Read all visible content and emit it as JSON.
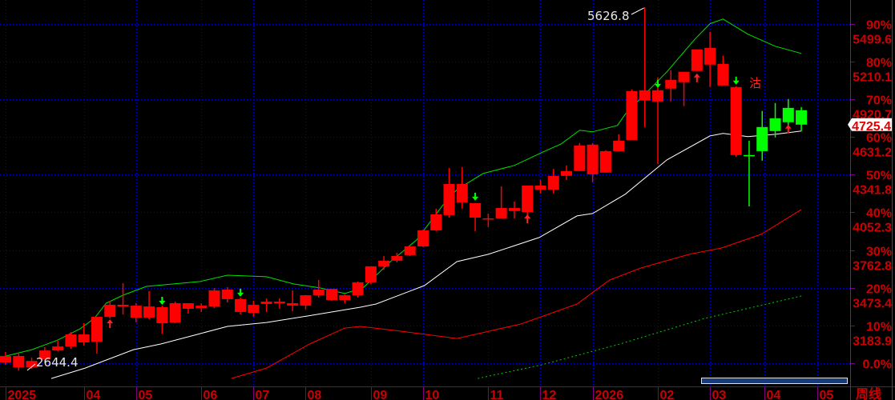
{
  "chart_data": {
    "type": "candlestick",
    "period_label": "周线",
    "ylim": [
      2716,
      5682
    ],
    "base_price": 2894.4,
    "current_price": "4725.4",
    "y_axis": [
      {
        "pct": "90%",
        "price": "5499.6",
        "value": 5499.6
      },
      {
        "pct": "80%",
        "price": "5210.1",
        "value": 5210.1
      },
      {
        "pct": "70%",
        "price": "4920.7",
        "value": 4920.7
      },
      {
        "pct": "60%",
        "price": "4631.2",
        "value": 4631.2
      },
      {
        "pct": "50%",
        "price": "4341.8",
        "value": 4341.8
      },
      {
        "pct": "40%",
        "price": "4052.3",
        "value": 4052.3
      },
      {
        "pct": "30%",
        "price": "3762.8",
        "value": 3762.8
      },
      {
        "pct": "20%",
        "price": "3473.4",
        "value": 3473.4
      },
      {
        "pct": "10%",
        "price": "3183.9",
        "value": 3183.9
      },
      {
        "pct": "0.0%",
        "price": "",
        "value": 2894.4
      }
    ],
    "x_ticks": [
      {
        "label": "2025",
        "week": 0
      },
      {
        "label": "04",
        "week": 6
      },
      {
        "label": "05",
        "week": 10
      },
      {
        "label": "06",
        "week": 15
      },
      {
        "label": "07",
        "week": 19
      },
      {
        "label": "08",
        "week": 23
      },
      {
        "label": "09",
        "week": 28
      },
      {
        "label": "10",
        "week": 32
      },
      {
        "label": "11",
        "week": 37
      },
      {
        "label": "12",
        "week": 41
      },
      {
        "label": "2026",
        "week": 45
      },
      {
        "label": "02",
        "week": 50
      },
      {
        "label": "03",
        "week": 54
      },
      {
        "label": "04",
        "week": 58.2
      },
      {
        "label": "05",
        "week": 62.2
      }
    ],
    "candles_ohlc_color": [
      [
        2900,
        2980,
        2882,
        2950,
        "r"
      ],
      [
        2863,
        2974,
        2839,
        2950,
        "r"
      ],
      [
        2863,
        2937,
        2851,
        2912,
        "r"
      ],
      [
        2925,
        3017,
        2906,
        2992,
        "r"
      ],
      [
        2992,
        3066,
        2986,
        3023,
        "r"
      ],
      [
        3023,
        3134,
        3005,
        3115,
        "r"
      ],
      [
        3054,
        3201,
        3029,
        3115,
        "r"
      ],
      [
        3060,
        3250,
        2968,
        3250,
        "r"
      ],
      [
        3250,
        3373,
        3238,
        3343,
        "r"
      ],
      [
        3330,
        3509,
        3269,
        3343,
        "r"
      ],
      [
        3244,
        3355,
        3207,
        3336,
        "r"
      ],
      [
        3244,
        3447,
        3232,
        3330,
        "r"
      ],
      [
        3201,
        3336,
        3121,
        3324,
        "r"
      ],
      [
        3207,
        3367,
        3201,
        3355,
        "r"
      ],
      [
        3312,
        3355,
        3275,
        3355,
        "r"
      ],
      [
        3318,
        3355,
        3287,
        3336,
        "r"
      ],
      [
        3330,
        3472,
        3318,
        3453,
        "r"
      ],
      [
        3386,
        3478,
        3361,
        3459,
        "r"
      ],
      [
        3287,
        3398,
        3269,
        3386,
        "r"
      ],
      [
        3281,
        3373,
        3250,
        3343,
        "r"
      ],
      [
        3349,
        3392,
        3287,
        3367,
        "r"
      ],
      [
        3355,
        3392,
        3312,
        3367,
        "r"
      ],
      [
        3336,
        3453,
        3293,
        3355,
        "r"
      ],
      [
        3336,
        3416,
        3306,
        3416,
        "r"
      ],
      [
        3416,
        3533,
        3398,
        3459,
        "r"
      ],
      [
        3379,
        3465,
        3373,
        3465,
        "r"
      ],
      [
        3379,
        3422,
        3355,
        3416,
        "r"
      ],
      [
        3416,
        3521,
        3398,
        3515,
        "r"
      ],
      [
        3515,
        3638,
        3502,
        3638,
        "r"
      ],
      [
        3638,
        3717,
        3613,
        3681,
        "r"
      ],
      [
        3681,
        3742,
        3668,
        3717,
        "r"
      ],
      [
        3724,
        3797,
        3717,
        3791,
        "r"
      ],
      [
        3791,
        3920,
        3785,
        3914,
        "r"
      ],
      [
        3914,
        4080,
        3908,
        4037,
        "r"
      ],
      [
        4031,
        4393,
        4012,
        4270,
        "r"
      ],
      [
        4129,
        4400,
        4080,
        4270,
        "r"
      ],
      [
        4012,
        4123,
        3908,
        4123,
        "r"
      ],
      [
        4000,
        4043,
        3939,
        4006,
        "r"
      ],
      [
        4006,
        4252,
        4006,
        4086,
        "r"
      ],
      [
        4062,
        4135,
        4006,
        4086,
        "r"
      ],
      [
        4055,
        4258,
        4006,
        4258,
        "r"
      ],
      [
        4227,
        4301,
        4197,
        4258,
        "r"
      ],
      [
        4227,
        4387,
        4197,
        4332,
        "r"
      ],
      [
        4332,
        4412,
        4301,
        4369,
        "r"
      ],
      [
        4369,
        4584,
        4369,
        4565,
        "r"
      ],
      [
        4344,
        4584,
        4283,
        4572,
        "r"
      ],
      [
        4357,
        4529,
        4357,
        4522,
        "r"
      ],
      [
        4522,
        4651,
        4522,
        4602,
        "r"
      ],
      [
        4608,
        4996,
        4608,
        4983,
        "r"
      ],
      [
        4910,
        5626.8,
        4707,
        4989,
        "r"
      ],
      [
        4903,
        5088,
        4424,
        4989,
        "r"
      ],
      [
        5002,
        5143,
        4903,
        5069,
        "r"
      ],
      [
        5051,
        5131,
        4867,
        5131,
        "r"
      ],
      [
        5137,
        5303,
        5137,
        5303,
        "r"
      ],
      [
        5186,
        5438,
        5014,
        5315,
        "r"
      ],
      [
        5026,
        5254,
        5026,
        5192,
        "r"
      ],
      [
        4492,
        5020,
        4479,
        5014,
        "r"
      ],
      [
        4492,
        4602,
        4098,
        4486,
        "g"
      ],
      [
        4707,
        4830,
        4449,
        4522,
        "g"
      ],
      [
        4774,
        4891,
        4627,
        4676,
        "g"
      ],
      [
        4854,
        4922,
        4670,
        4744,
        "g"
      ],
      [
        4836,
        4860,
        4676,
        4725.4,
        "g"
      ]
    ],
    "series": [
      {
        "name": "upper-band",
        "color": "#00e000",
        "style": "solid",
        "points": [
          [
            0,
            2949
          ],
          [
            2,
            2998
          ],
          [
            4,
            3072
          ],
          [
            5.7,
            3158
          ],
          [
            6.8,
            3238
          ],
          [
            7.7,
            3355
          ],
          [
            9,
            3416
          ],
          [
            10.8,
            3484
          ],
          [
            14.9,
            3521
          ],
          [
            17,
            3570
          ],
          [
            20,
            3558
          ],
          [
            22.1,
            3502
          ],
          [
            24.1,
            3472
          ],
          [
            26,
            3429
          ],
          [
            27.4,
            3472
          ],
          [
            29.5,
            3674
          ],
          [
            31.5,
            3840
          ],
          [
            33.5,
            4105
          ],
          [
            34.6,
            4227
          ],
          [
            36.6,
            4350
          ],
          [
            39,
            4412
          ],
          [
            41.2,
            4516
          ],
          [
            42.6,
            4578
          ],
          [
            44,
            4682
          ],
          [
            45,
            4670
          ],
          [
            46.9,
            4719
          ],
          [
            47.5,
            4805
          ],
          [
            48.7,
            4928
          ],
          [
            50.7,
            5131
          ],
          [
            52.8,
            5377
          ],
          [
            54,
            5500
          ],
          [
            55,
            5536
          ],
          [
            56.9,
            5420
          ],
          [
            59,
            5327
          ],
          [
            61,
            5272
          ]
        ]
      },
      {
        "name": "ma-white",
        "color": "#ffffff",
        "style": "solid",
        "points": [
          [
            3.5,
            2777
          ],
          [
            6.1,
            2857
          ],
          [
            9.8,
            2998
          ],
          [
            11.9,
            3042
          ],
          [
            14.9,
            3121
          ],
          [
            17,
            3177
          ],
          [
            20,
            3207
          ],
          [
            23.1,
            3256
          ],
          [
            27.2,
            3324
          ],
          [
            28.4,
            3349
          ],
          [
            32.1,
            3490
          ],
          [
            34.6,
            3674
          ],
          [
            37,
            3730
          ],
          [
            40.9,
            3859
          ],
          [
            43.8,
            4025
          ],
          [
            45,
            4043
          ],
          [
            47.5,
            4191
          ],
          [
            50.7,
            4455
          ],
          [
            54,
            4639
          ],
          [
            55,
            4658
          ],
          [
            56.9,
            4633
          ],
          [
            59,
            4651
          ],
          [
            61,
            4676
          ]
        ]
      },
      {
        "name": "ma-red",
        "color": "#ff0000",
        "style": "solid",
        "points": [
          [
            17.3,
            2777
          ],
          [
            20,
            2857
          ],
          [
            23.3,
            3042
          ],
          [
            26,
            3164
          ],
          [
            27.2,
            3177
          ],
          [
            30.3,
            3140
          ],
          [
            34.6,
            3084
          ],
          [
            39.5,
            3195
          ],
          [
            43.8,
            3349
          ],
          [
            46.3,
            3533
          ],
          [
            48.7,
            3625
          ],
          [
            52.4,
            3730
          ],
          [
            54.9,
            3779
          ],
          [
            57.9,
            3883
          ],
          [
            61,
            4074
          ]
        ]
      },
      {
        "name": "ma-green-dashed",
        "color": "#00d000",
        "style": "dashed",
        "points": [
          [
            36.2,
            2777
          ],
          [
            41.1,
            2882
          ],
          [
            47.1,
            3042
          ],
          [
            53.6,
            3238
          ],
          [
            61,
            3410
          ]
        ]
      }
    ],
    "signals": [
      {
        "week": 8,
        "type": "up-arrow"
      },
      {
        "week": 12,
        "type": "down-arrow"
      },
      {
        "week": 18,
        "type": "down-arrow"
      },
      {
        "week": 36,
        "type": "down-arrow"
      },
      {
        "week": 40,
        "type": "up-arrow"
      },
      {
        "week": 50,
        "type": "down-arrow"
      },
      {
        "week": 53,
        "type": "up-arrow"
      },
      {
        "week": 56,
        "type": "down-arrow"
      },
      {
        "week": 60,
        "type": "up-arrow"
      }
    ],
    "annotations": {
      "high_label": "5626.8",
      "high_week": 49,
      "high_value": 5626.8,
      "low_label": "2644.4",
      "sell_mark": "沽"
    }
  }
}
